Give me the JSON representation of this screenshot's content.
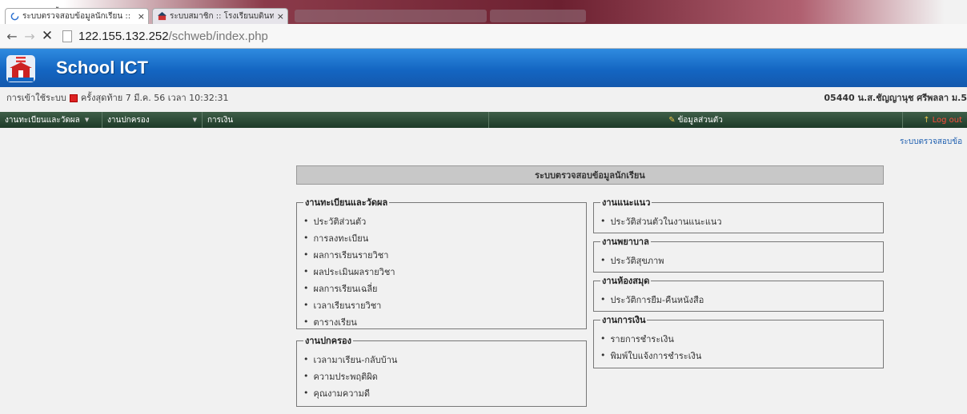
{
  "browser": {
    "os_title_fragment": "ู",
    "tabs": [
      {
        "label": "ระบบตรวจสอบข้อมูลนักเรียน ::",
        "close": "×",
        "active": true
      },
      {
        "label": "ระบบสมาชิก :: โรงเรียนบดินทร",
        "close": "×",
        "active": false
      }
    ],
    "url_host": "122.155.132.252",
    "url_path": "/schweb/index.php",
    "back": "←",
    "forward": "→",
    "stop": "✕"
  },
  "site": {
    "brand": "School ICT",
    "login_info_prefix": "การเข้าใช้ระบบ",
    "login_info_suffix": "ครั้งสุดท้าย   7 มี.ค. 56   เวลา 10:32:31",
    "user_info": "05440  น.ส.ชัญญานุช ศรีพลลา  ม.5",
    "menu": {
      "registration": "งานทะเบียนและวัดผล",
      "governance": "งานปกครอง",
      "finance": "การเงิน",
      "personal": "ข้อมูลส่วนตัว",
      "logout": "Log out"
    },
    "breadcrumb": "ระบบตรวจสอบข้อ"
  },
  "main": {
    "title": "ระบบตรวจสอบข้อมูลนักเรียน",
    "groups": {
      "registration": {
        "title": "งานทะเบียนและวัดผล",
        "items": [
          "ประวัติส่วนตัว",
          "การลงทะเบียน",
          "ผลการเรียนรายวิชา",
          "ผลประเมินผลรายวิชา",
          "ผลการเรียนเฉลี่ย",
          "เวลาเรียนรายวิชา",
          "ตารางเรียน"
        ]
      },
      "governance": {
        "title": "งานปกครอง",
        "items": [
          "เวลามาเรียน-กลับบ้าน",
          "ความประพฤติผิด",
          "คุณงามความดี"
        ]
      },
      "guidance": {
        "title": "งานแนะแนว",
        "items": [
          "ประวัติส่วนตัวในงานแนะแนว"
        ]
      },
      "nursing": {
        "title": "งานพยาบาล",
        "items": [
          "ประวัติสุขภาพ"
        ]
      },
      "library": {
        "title": "งานห้องสมุด",
        "items": [
          "ประวัติการยืม-คืนหนังสือ"
        ]
      },
      "finance": {
        "title": "งานการเงิน",
        "items": [
          "รายการชำระเงิน",
          "พิมพ์ใบแจ้งการชำระเงิน"
        ]
      }
    }
  },
  "colors": {
    "banner": "#1466c2",
    "menubar": "#1d3a28",
    "logout": "#ff4b3b"
  }
}
